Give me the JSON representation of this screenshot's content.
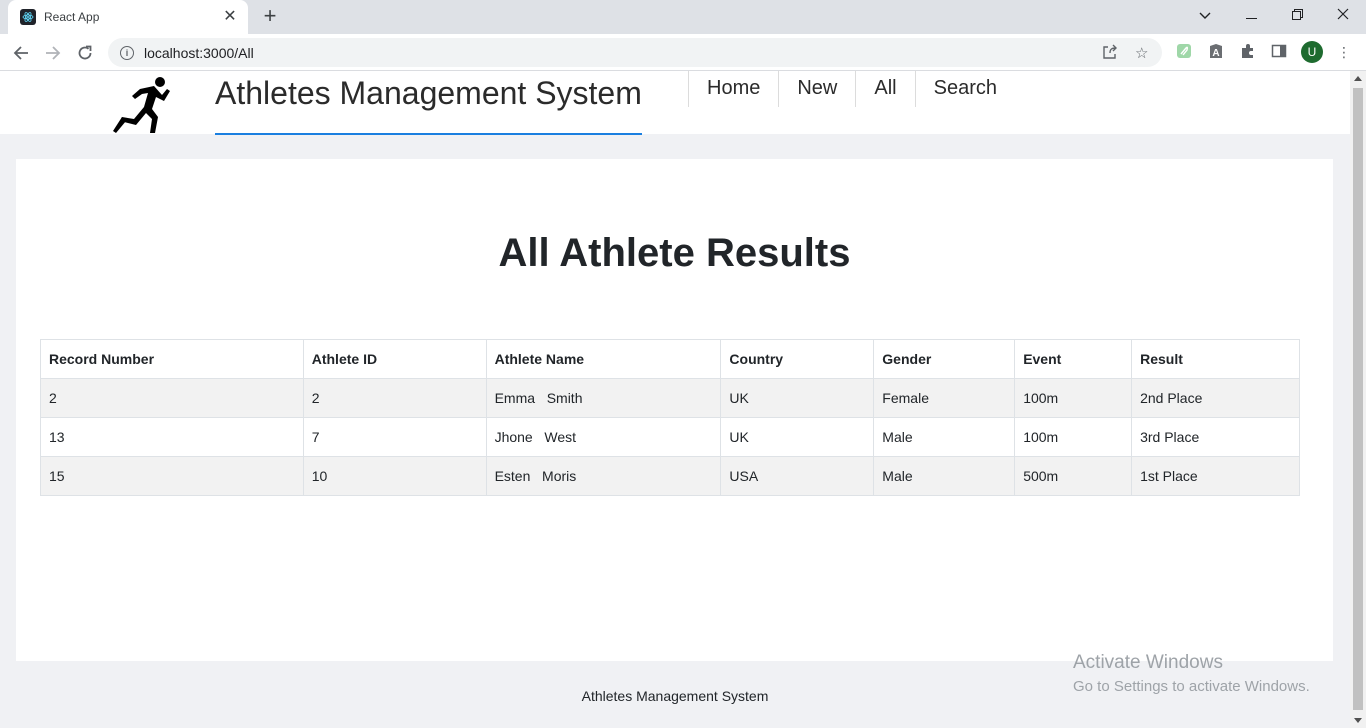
{
  "browser": {
    "tab_title": "React App",
    "url": "localhost:3000/All",
    "profile_initial": "U"
  },
  "site": {
    "brand": "Athletes Management System",
    "nav": [
      {
        "label": "Home"
      },
      {
        "label": "New"
      },
      {
        "label": "All"
      },
      {
        "label": "Search"
      }
    ]
  },
  "main": {
    "heading": "All Athlete Results",
    "table": {
      "headers": [
        "Record Number",
        "Athlete ID",
        "Athlete Name",
        "Country",
        "Gender",
        "Event",
        "Result"
      ],
      "rows": [
        [
          "2",
          "2",
          "Emma   Smith",
          "UK",
          "Female",
          "100m",
          "2nd Place"
        ],
        [
          "13",
          "7",
          "Jhone   West",
          "UK",
          "Male",
          "100m",
          "3rd Place"
        ],
        [
          "15",
          "10",
          "Esten   Moris",
          "USA",
          "Male",
          "500m",
          "1st Place"
        ]
      ]
    }
  },
  "footer": {
    "text": "Athletes Management System"
  },
  "watermark": {
    "line1": "Activate Windows",
    "line2": "Go to Settings to activate Windows."
  },
  "colors": {
    "accent": "#1a7fe0",
    "row_stripe": "#f2f2f2",
    "page_bg": "#f0f1f4"
  }
}
